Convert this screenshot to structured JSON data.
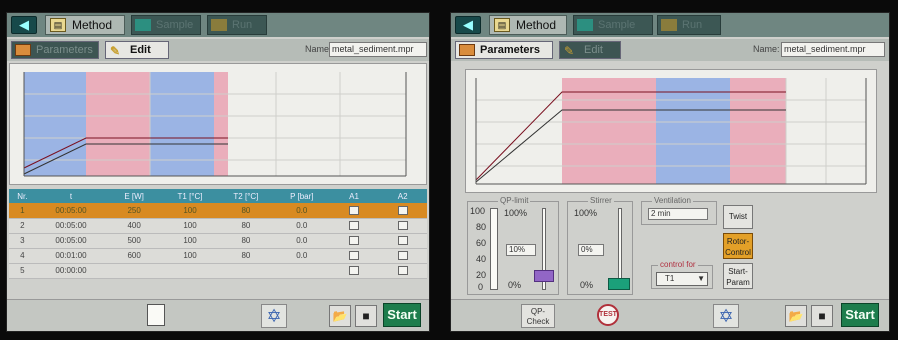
{
  "left": {
    "header": {
      "method_tab": "Method",
      "sample_tab": "Sample",
      "run_tab": "Run"
    },
    "subtabs": {
      "parameters": "Parameters",
      "edit": "Edit"
    },
    "name_label": "Name",
    "name_value": "metal_sediment.mpr",
    "table": {
      "columns": [
        "Nr.",
        "t",
        "E [W]",
        "T1 [°C]",
        "T2 [°C]",
        "P [bar]",
        "A1",
        "A2"
      ],
      "rows": [
        [
          "1",
          "00:05:00",
          "250",
          "100",
          "80",
          "0.0"
        ],
        [
          "2",
          "00:05:00",
          "400",
          "100",
          "80",
          "0.0"
        ],
        [
          "3",
          "00:05:00",
          "500",
          "100",
          "80",
          "0.0"
        ],
        [
          "4",
          "00:01:00",
          "600",
          "100",
          "80",
          "0.0"
        ],
        [
          "5",
          "00:00:00",
          "",
          "",
          "",
          ""
        ]
      ],
      "selected_row": 0
    },
    "buttons": {
      "start": "Start"
    }
  },
  "right": {
    "header": {
      "method_tab": "Method",
      "sample_tab": "Sample",
      "run_tab": "Run"
    },
    "subtabs": {
      "parameters": "Parameters",
      "edit": "Edit"
    },
    "name_label": "Name:",
    "name_value": "metal_sediment.mpr",
    "qp_group": {
      "title": "QP-limit",
      "scale": [
        "100",
        "80",
        "60",
        "40",
        "20",
        "0"
      ],
      "top_val": "100%",
      "mid_val": "10%",
      "bot_val": "0%",
      "purple_level": 0.1
    },
    "stirrer_group": {
      "title": "Stirrer",
      "top_val": "100%",
      "mid_val": "0%",
      "bot_val": "0%"
    },
    "ventilation": {
      "title": "Ventilation",
      "value": "2 min"
    },
    "control_for": {
      "title": "control for",
      "value": "T1"
    },
    "buttons": {
      "twist": "Twist",
      "rotor_control": "Rotor-Control",
      "start_param": "Start-Param",
      "qp_check": "QP-Check",
      "test": "TEST",
      "start": "Start"
    }
  },
  "colors": {
    "blue": "#9bb4e4",
    "pink": "#eaaebb",
    "accent": "#1d7d4c",
    "orange": "#d88a22"
  }
}
